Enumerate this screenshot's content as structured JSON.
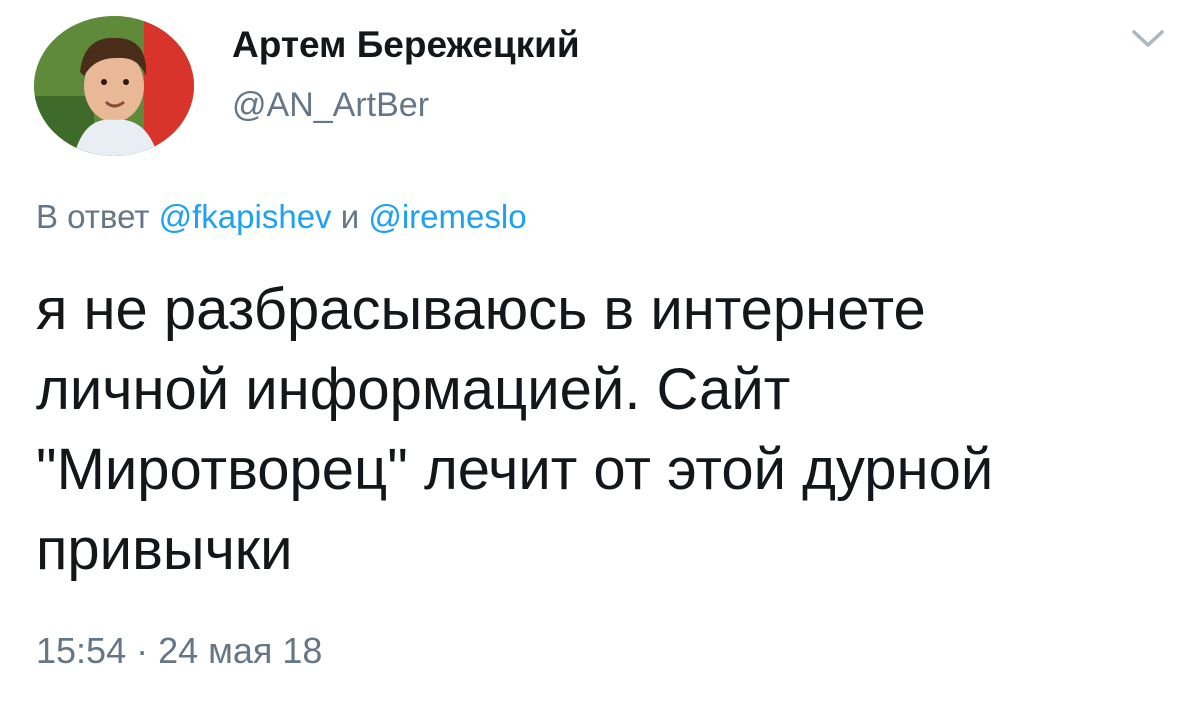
{
  "author": {
    "display_name": "Артем Бережецкий",
    "handle": "@AN_ArtBer"
  },
  "menu": {
    "icon": "chevron-down-icon"
  },
  "reply": {
    "prefix": "В ответ",
    "user1": "@fkapishev",
    "conjunction": "и",
    "user2": "@iremeslo"
  },
  "tweet": {
    "lines": [
      "я не разбрасываюсь в интернете",
      "личной информацией. Сайт",
      "\"Миротворец\" лечит от этой дурной",
      "привычки"
    ]
  },
  "meta": {
    "timestamp": "15:54 · 24 мая 18"
  },
  "colors": {
    "text": "#14171a",
    "secondary": "#657786",
    "link": "#1da1f2"
  }
}
